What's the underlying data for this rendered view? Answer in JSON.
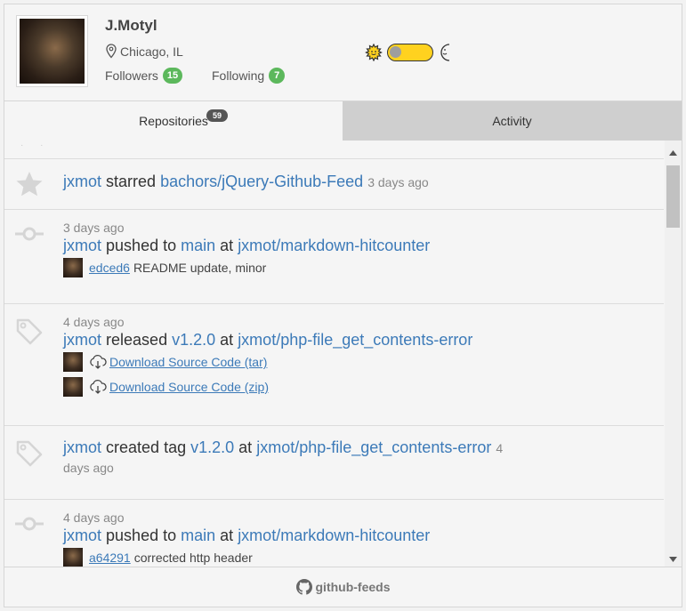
{
  "profile": {
    "name": "J.Motyl",
    "location": "Chicago, IL",
    "followers_label": "Followers",
    "followers_count": "15",
    "following_label": "Following",
    "following_count": "7"
  },
  "theme_toggle": {
    "left_icon": "sun-icon",
    "right_icon": "moon-icon",
    "state": "light"
  },
  "tabs": [
    {
      "label": "Repositories",
      "count": "59",
      "selected": true
    },
    {
      "label": "Activity",
      "selected": false
    }
  ],
  "feed": [
    {
      "icon": "star-icon",
      "user": "jxmot",
      "action": "starred",
      "repo": "bachors/jQuery-Github-Feed",
      "time": "3 days ago"
    },
    {
      "icon": "commit-icon",
      "time": "3 days ago",
      "user": "jxmot",
      "action": "pushed to",
      "branch": "main",
      "at": "at",
      "repo": "jxmot/markdown-hitcounter",
      "commit_sha": "edced6",
      "commit_msg": "README update, minor"
    },
    {
      "icon": "tag-icon",
      "time": "4 days ago",
      "user": "jxmot",
      "action": "released",
      "tag": "v1.2.0",
      "at": "at",
      "repo": "jxmot/php-file_get_contents-error",
      "downloads": [
        "Download Source Code (tar)",
        "Download Source Code (zip)"
      ]
    },
    {
      "icon": "tag-icon",
      "user": "jxmot",
      "action": "created tag",
      "tag": "v1.2.0",
      "at": "at",
      "repo": "jxmot/php-file_get_contents-error",
      "time_a": "4",
      "time_b": "days ago"
    },
    {
      "icon": "commit-icon",
      "time": "4 days ago",
      "user": "jxmot",
      "action": "pushed to",
      "branch": "main",
      "at": "at",
      "repo": "jxmot/markdown-hitcounter",
      "commit_sha": "a64291",
      "commit_msg": "corrected http header"
    }
  ],
  "footer": {
    "label": "github-feeds",
    "icon": "github-icon"
  }
}
